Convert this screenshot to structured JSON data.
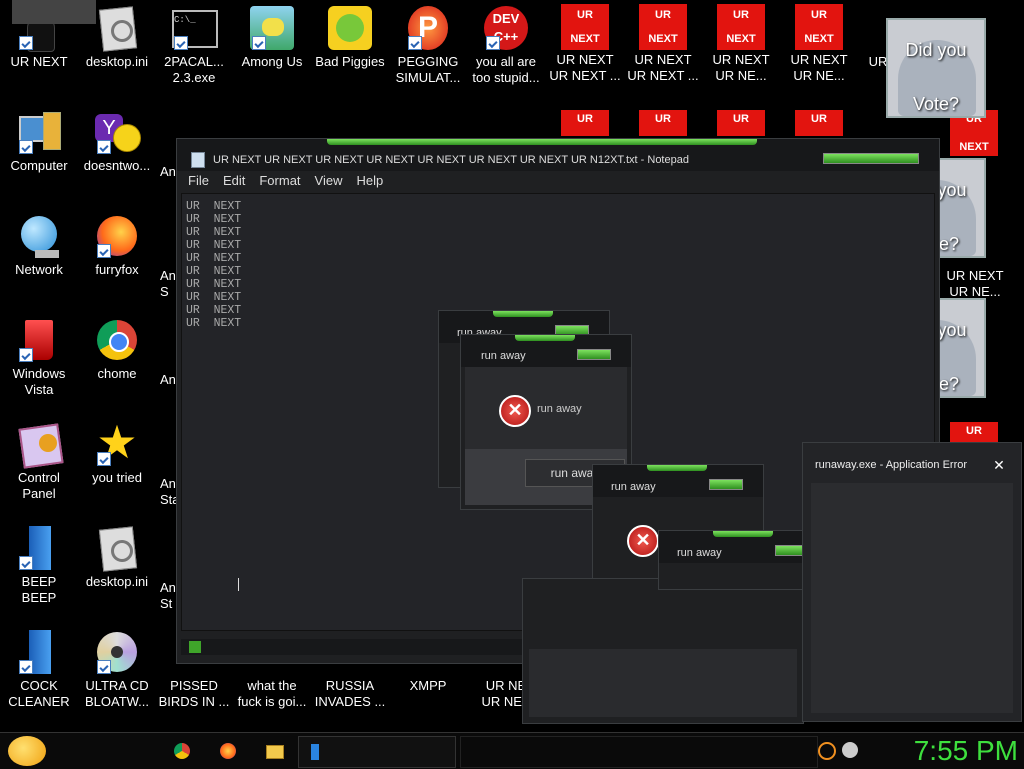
{
  "desktop": {
    "icons": [
      {
        "label": "UR NEXT",
        "icon": "black-cat-icon"
      },
      {
        "label": "desktop.ini",
        "icon": "settings-file-icon"
      },
      {
        "label": "2PACAL...\n2.3.exe",
        "icon": "terminal-icon"
      },
      {
        "label": "Among Us",
        "icon": "game-icon"
      },
      {
        "label": "Bad Piggies",
        "icon": "pig-icon"
      },
      {
        "label": "PEGGING\nSIMULAT...",
        "icon": "p-logo-icon"
      },
      {
        "label": "you all are\ntoo stupid...",
        "icon": "devcpp-icon"
      },
      {
        "label": "UR NEXT\nUR NEXT ...",
        "icon": "ur-next-icon"
      },
      {
        "label": "UR NEXT\nUR NEXT ...",
        "icon": "ur-next-icon"
      },
      {
        "label": "UR NEXT\nUR NE...",
        "icon": "ur-next-icon"
      },
      {
        "label": "UR NEXT\nUR NE...",
        "icon": "ur-next-icon"
      },
      {
        "label": "Computer",
        "icon": "computer-icon"
      },
      {
        "label": "doesntwo...",
        "icon": "yahoo-icon"
      },
      {
        "label": "Network",
        "icon": "network-icon"
      },
      {
        "label": "furryfox",
        "icon": "firefox-icon"
      },
      {
        "label": "Windows\nVista",
        "icon": "recycle-bin-icon"
      },
      {
        "label": "chome",
        "icon": "chrome-icon"
      },
      {
        "label": "Control\nPanel",
        "icon": "control-panel-icon"
      },
      {
        "label": "you tried",
        "icon": "star-icon"
      },
      {
        "label": "BEEP\nBEEP",
        "icon": "blue-file-icon"
      },
      {
        "label": "desktop.ini",
        "icon": "settings-file-icon"
      },
      {
        "label": "COCK\nCLEANER",
        "icon": "blue-file-icon"
      },
      {
        "label": "ULTRA CD\nBLOATW...",
        "icon": "cd-icon"
      },
      {
        "label": "PISSED\nBIRDS IN ...",
        "icon": "bird-icon"
      },
      {
        "label": "what the\nfuck is goi...",
        "icon": "file-icon"
      },
      {
        "label": "RUSSIA\nINVADES ...",
        "icon": "file-icon"
      },
      {
        "label": "XMPP",
        "icon": "file-icon"
      },
      {
        "label": "UR NE\nUR NEX",
        "icon": "ur-next-icon"
      },
      {
        "label": "UR NEXT\nUR NE...",
        "icon": "ur-next-icon"
      },
      {
        "label": "UR",
        "icon": "ur-next-icon"
      },
      {
        "label": "UR",
        "icon": "ur-next-icon"
      },
      {
        "label": "An",
        "icon": "file-icon"
      },
      {
        "label": "An\nS",
        "icon": "file-icon"
      },
      {
        "label": "An",
        "icon": "file-icon"
      },
      {
        "label": "An\nSta",
        "icon": "file-icon"
      },
      {
        "label": "An\nSt",
        "icon": "file-icon"
      },
      {
        "label": "XT",
        "icon": "file-icon"
      },
      {
        "label": "XT",
        "icon": "file-icon"
      }
    ],
    "ur_tile": {
      "top": "UR",
      "bottom": "NEXT"
    },
    "vote_tiles": [
      {
        "line1": "Did you",
        "line2": "Vote?"
      },
      {
        "line1": "Did you",
        "line2": "Vote?"
      },
      {
        "line1": "Did you",
        "line2": "Vote?"
      }
    ]
  },
  "notepad": {
    "title": "UR NEXT UR NEXT UR NEXT UR NEXT UR NEXT UR NEXT UR NEXT UR N12XT.txt - Notepad",
    "menu": [
      "File",
      "Edit",
      "Format",
      "View",
      "Help"
    ],
    "content": "UR  NEXT\nUR  NEXT\nUR  NEXT\nUR  NEXT\nUR  NEXT\nUR  NEXT\nUR  NEXT\nUR  NEXT\nUR  NEXT\nUR  NEXT"
  },
  "dialogs": {
    "title": "run away",
    "message": "run away",
    "button": "run away",
    "error_title": "runaway.exe - Application Error",
    "close_glyph": "✕"
  },
  "taskbar": {
    "clock": "7:55 PM",
    "clock_color": "#3ee03e"
  }
}
